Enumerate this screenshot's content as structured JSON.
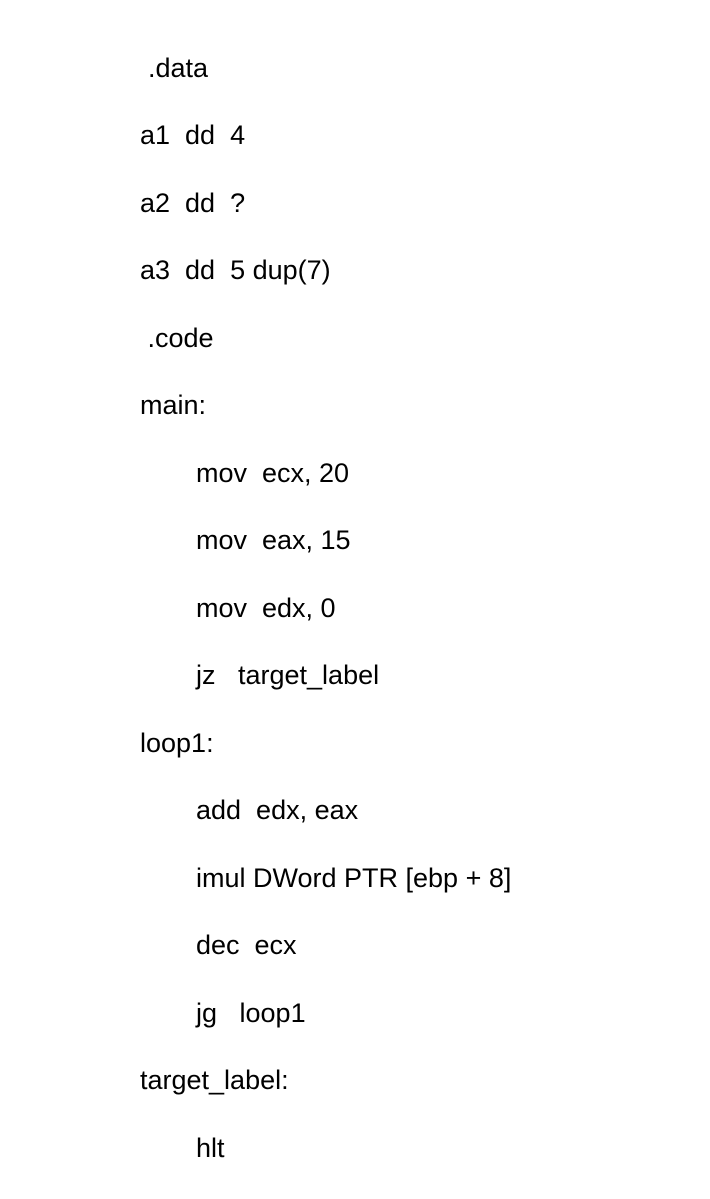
{
  "code": {
    "l1": ".data",
    "l2": "a1  dd  4",
    "l3": "a2  dd  ?",
    "l4": "a3  dd  5 dup(7)",
    "l5": " .code",
    "l6": "main:",
    "l7": "mov  ecx, 20",
    "l8": "mov  eax, 15",
    "l9": "mov  edx, 0",
    "l10": "jz   target_label",
    "l11": "loop1:",
    "l12": "add  edx, eax",
    "l13": "imul DWord PTR [ebp + 8]",
    "l14": "dec  ecx",
    "l15": "jg   loop1",
    "l16": "target_label:",
    "l17": "hlt"
  }
}
